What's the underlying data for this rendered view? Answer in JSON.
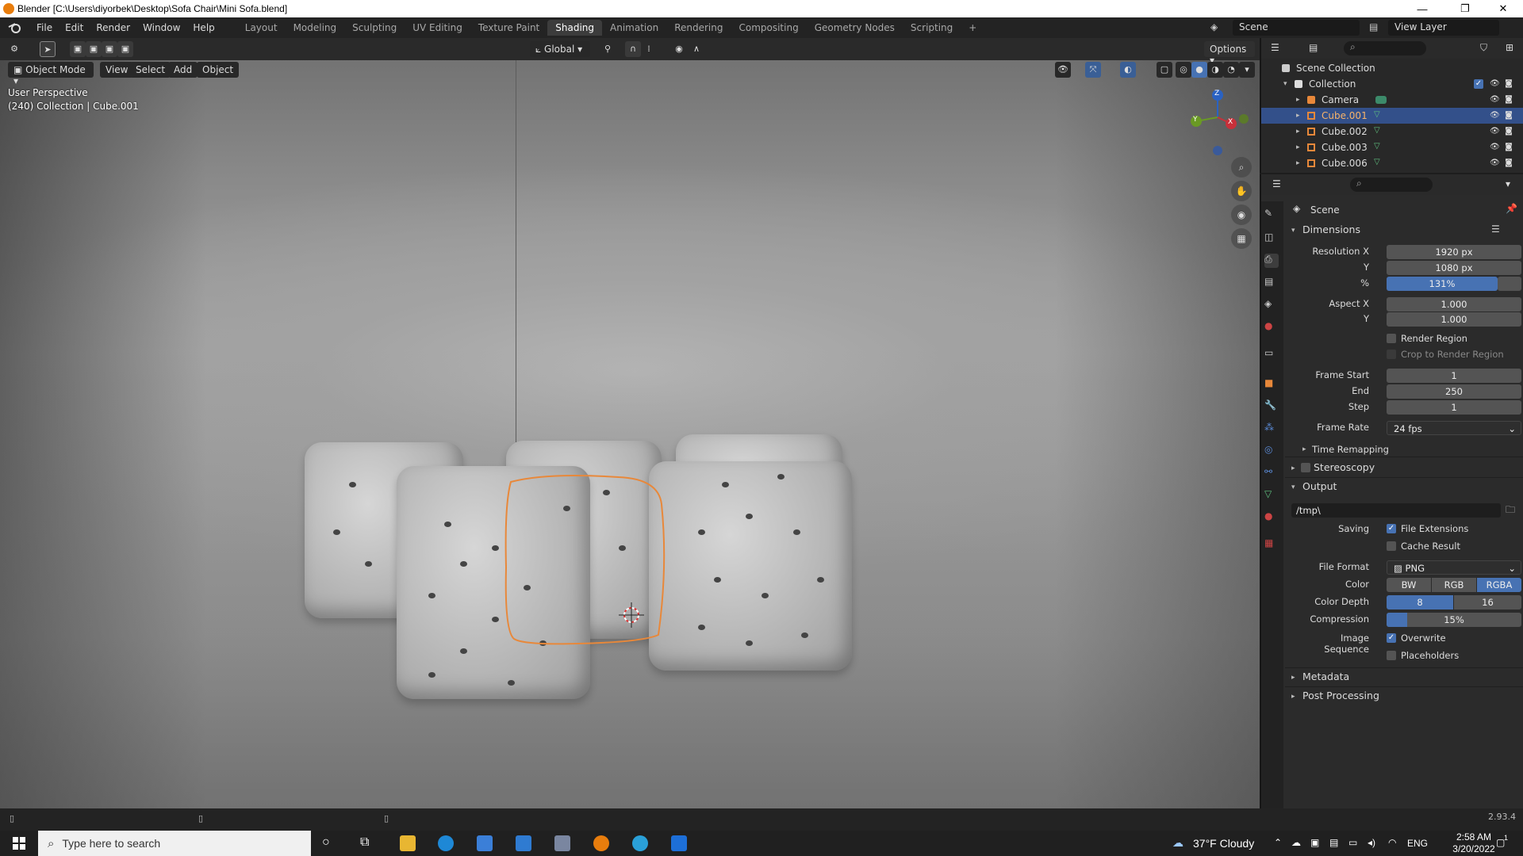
{
  "window": {
    "title": "Blender [C:\\Users\\diyorbek\\Desktop\\Sofa Chair\\Mini Sofa.blend]",
    "controls": [
      "—",
      "❐",
      "✕"
    ]
  },
  "menu": [
    "File",
    "Edit",
    "Render",
    "Window",
    "Help"
  ],
  "workspaces": [
    "Layout",
    "Modeling",
    "Sculpting",
    "UV Editing",
    "Texture Paint",
    "Shading",
    "Animation",
    "Rendering",
    "Compositing",
    "Geometry Nodes",
    "Scripting",
    "+"
  ],
  "active_workspace": "Shading",
  "scene_name": "Scene",
  "view_layer": "View Layer",
  "viewport": {
    "transform_orientation": "Global",
    "options_label": "Options",
    "mode": "Object Mode",
    "header_menus": [
      "View",
      "Select",
      "Add",
      "Object"
    ],
    "overlay_line1": "User Perspective",
    "overlay_line2": "(240) Collection | Cube.001",
    "gizmo_axes": [
      "Z",
      "Y",
      "X"
    ]
  },
  "outliner": {
    "root": "Scene Collection",
    "collection": "Collection",
    "items": [
      {
        "name": "Camera",
        "selected": false
      },
      {
        "name": "Cube.001",
        "selected": true
      },
      {
        "name": "Cube.002",
        "selected": false
      },
      {
        "name": "Cube.003",
        "selected": false
      },
      {
        "name": "Cube.006",
        "selected": false
      }
    ]
  },
  "properties": {
    "context": "Scene",
    "dimensions": {
      "title": "Dimensions",
      "resolution_x_label": "Resolution X",
      "resolution_x": "1920 px",
      "y_label": "Y",
      "resolution_y": "1080 px",
      "percent_label": "%",
      "percent": "131%",
      "aspect_x_label": "Aspect X",
      "aspect_x": "1.000",
      "aspect_y_label": "Y",
      "aspect_y": "1.000",
      "render_region": "Render Region",
      "crop_region": "Crop to Render Region",
      "frame_start_label": "Frame Start",
      "frame_start": "1",
      "end_label": "End",
      "frame_end": "250",
      "step_label": "Step",
      "frame_step": "1",
      "frame_rate_label": "Frame Rate",
      "frame_rate": "24 fps",
      "time_remapping": "Time Remapping",
      "stereoscopy": "Stereoscopy"
    },
    "output": {
      "title": "Output",
      "path": "/tmp\\",
      "saving_label": "Saving",
      "file_extensions": "File Extensions",
      "cache_result": "Cache Result",
      "file_format_label": "File Format",
      "file_format": "PNG",
      "color_label": "Color",
      "color_options": [
        "BW",
        "RGB",
        "RGBA"
      ],
      "color_selected": "RGBA",
      "color_depth_label": "Color Depth",
      "color_depth_options": [
        "8",
        "16"
      ],
      "color_depth_selected": "8",
      "compression_label": "Compression",
      "compression": "15%",
      "compression_fraction": 0.15,
      "image_sequence_label": "Image Sequence",
      "overwrite": "Overwrite",
      "placeholders": "Placeholders"
    },
    "metadata": "Metadata",
    "post_processing": "Post Processing"
  },
  "status": {
    "version": "2.93.4"
  },
  "taskbar": {
    "search_placeholder": "Type here to search",
    "weather": "37°F  Cloudy",
    "language": "ENG",
    "time": "2:58 AM",
    "date": "3/20/2022",
    "notifications": "1"
  },
  "colors": {
    "selection_blue": "#4772b3",
    "outline_orange": "#e8883a",
    "blender_orange": "#e87d0d"
  }
}
